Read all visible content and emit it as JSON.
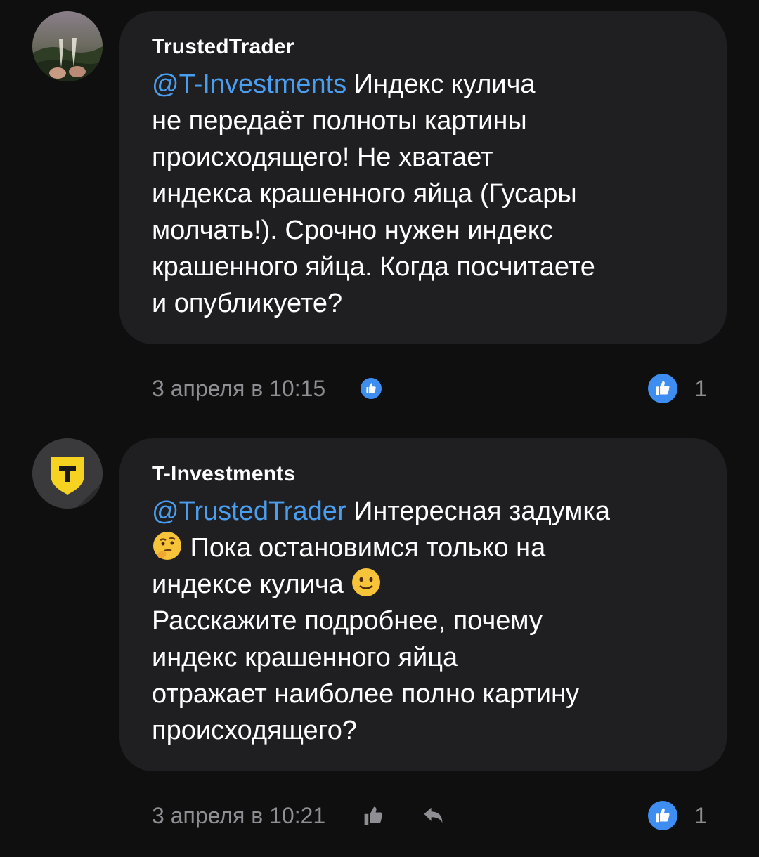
{
  "comments": [
    {
      "author": "TrustedTrader",
      "mention": "@T-Investments",
      "lines": [
        " Индекс кулича",
        "не передаёт полноты картины",
        "происходящего! Не хватает",
        "индекса крашенного яйца (Гусары",
        "молчать!). Срочно нужен индекс",
        "крашенного яйца. Когда посчитаете",
        "и опубликуете?"
      ],
      "timestamp": "3 апреля в 10:15",
      "likes": "1"
    },
    {
      "author": "T-Investments",
      "mention": "@TrustedTrader",
      "line1": " Интересная задумка",
      "line2": " Пока остановимся только на",
      "line3": "индексе кулича ",
      "lines_rest": [
        "Расскажите подробнее, почему",
        "индекс крашенного яйца",
        "отражает наиболее полно картину",
        "происходящего?"
      ],
      "timestamp": "3 апреля в 10:21",
      "likes": "1"
    }
  ],
  "icons": {
    "avatar1": "toast-photo-avatar",
    "avatar2": "t-shield-logo",
    "like": "thumbs-up-icon",
    "reply": "reply-arrow-icon",
    "emoji_thinking": "thinking-face-emoji",
    "emoji_smile": "slightly-smiling-face-emoji"
  },
  "colors": {
    "background": "#0f0f0f",
    "bubble": "#1f1f21",
    "mention": "#4a9ef0",
    "like_blue": "#3d8ef0",
    "muted": "#8e8e93",
    "brand_yellow": "#f5d320"
  }
}
